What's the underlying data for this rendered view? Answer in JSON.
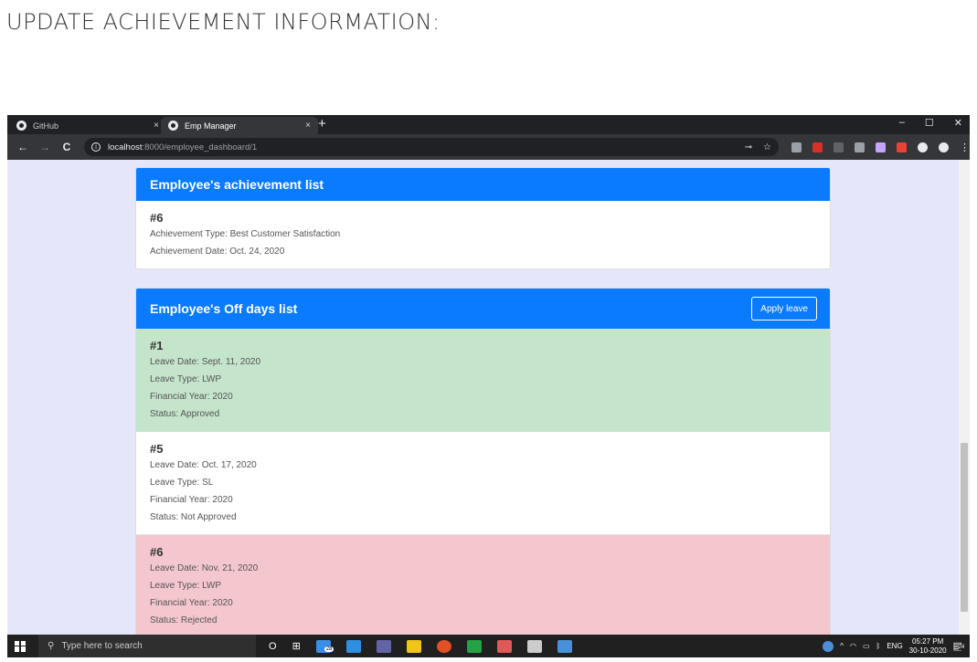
{
  "doc_heading": "UPDATE ACHIEVEMENT INFORMATION:",
  "browser": {
    "tabs": [
      {
        "label": "GitHub",
        "active": false
      },
      {
        "label": "Emp Manager",
        "active": true
      }
    ],
    "close_glyph": "×",
    "new_tab_glyph": "+",
    "window_controls": [
      "–",
      "☐",
      "✕"
    ],
    "nav": {
      "back": "←",
      "forward": "→",
      "reload": "C"
    },
    "url_host": "localhost",
    "url_path": ":8000/employee_dashboard/1",
    "info_glyph": "i",
    "omni_icons": [
      "key-icon",
      "star-icon"
    ],
    "extension_colors": [
      "#9aa0a6",
      "#d93025",
      "#5f6368",
      "#9aa0a6",
      "#c5a3ff",
      "#ea4335",
      "#e8eaed",
      "#e8eaed"
    ]
  },
  "achievements": {
    "header": "Employee's achievement list",
    "items": [
      {
        "num": "#6",
        "type": "Achievement Type: Best Customer Satisfaction",
        "date": "Achievement Date: Oct. 24, 2020"
      }
    ]
  },
  "off_days": {
    "header": "Employee's Off days list",
    "apply_button": "Apply leave",
    "items": [
      {
        "num": "#1",
        "date": "Leave Date: Sept. 11, 2020",
        "type": "Leave Type: LWP",
        "year": "Financial Year: 2020",
        "status": "Status: Approved",
        "variant": "green"
      },
      {
        "num": "#5",
        "date": "Leave Date: Oct. 17, 2020",
        "type": "Leave Type: SL",
        "year": "Financial Year: 2020",
        "status": "Status: Not Approved",
        "variant": "white"
      },
      {
        "num": "#6",
        "date": "Leave Date: Nov. 21, 2020",
        "type": "Leave Type: LWP",
        "year": "Financial Year: 2020",
        "status": "Status: Rejected",
        "variant": "red"
      }
    ]
  },
  "taskbar": {
    "search_placeholder": "Type here to search",
    "search_glyph": "⚲",
    "cortana_glyph": "O",
    "taskview_glyph": "⊞",
    "badge_mail": "28",
    "icon_colors": [
      "#3a8ee6",
      "#2f8ee0",
      "#6264a7",
      "#f0c419",
      "#e34f26",
      "#25a244",
      "#e05858",
      "#cccccc",
      "#4a90d9"
    ],
    "tray_chevron": "^",
    "lang": "ENG",
    "time": "05:27 PM",
    "date": "30-10-2020",
    "notif_count": "24"
  }
}
